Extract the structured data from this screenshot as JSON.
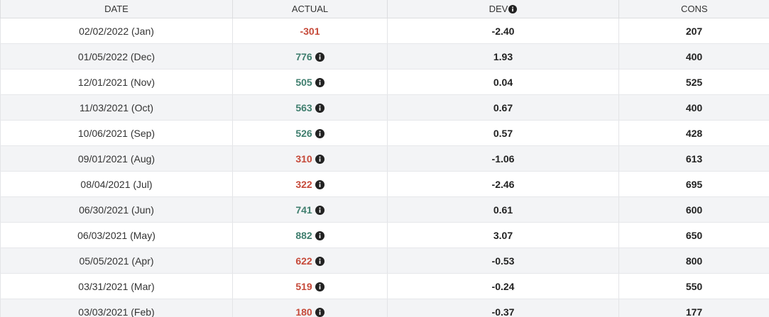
{
  "header": {
    "date": "DATE",
    "actual": "ACTUAL",
    "dev": "DEV",
    "cons": "CONS"
  },
  "colors": {
    "positive": "#3f7e6e",
    "negative": "#c64a3a"
  },
  "rows": [
    {
      "date": "02/02/2022 (Jan)",
      "actual": "-301",
      "status": "neg",
      "info": false,
      "dev": "-2.40",
      "cons": "207"
    },
    {
      "date": "01/05/2022 (Dec)",
      "actual": "776",
      "status": "pos",
      "info": true,
      "dev": "1.93",
      "cons": "400"
    },
    {
      "date": "12/01/2021 (Nov)",
      "actual": "505",
      "status": "pos",
      "info": true,
      "dev": "0.04",
      "cons": "525"
    },
    {
      "date": "11/03/2021 (Oct)",
      "actual": "563",
      "status": "pos",
      "info": true,
      "dev": "0.67",
      "cons": "400"
    },
    {
      "date": "10/06/2021 (Sep)",
      "actual": "526",
      "status": "pos",
      "info": true,
      "dev": "0.57",
      "cons": "428"
    },
    {
      "date": "09/01/2021 (Aug)",
      "actual": "310",
      "status": "neg",
      "info": true,
      "dev": "-1.06",
      "cons": "613"
    },
    {
      "date": "08/04/2021 (Jul)",
      "actual": "322",
      "status": "neg",
      "info": true,
      "dev": "-2.46",
      "cons": "695"
    },
    {
      "date": "06/30/2021 (Jun)",
      "actual": "741",
      "status": "pos",
      "info": true,
      "dev": "0.61",
      "cons": "600"
    },
    {
      "date": "06/03/2021 (May)",
      "actual": "882",
      "status": "pos",
      "info": true,
      "dev": "3.07",
      "cons": "650"
    },
    {
      "date": "05/05/2021 (Apr)",
      "actual": "622",
      "status": "neg",
      "info": true,
      "dev": "-0.53",
      "cons": "800"
    },
    {
      "date": "03/31/2021 (Mar)",
      "actual": "519",
      "status": "neg",
      "info": true,
      "dev": "-0.24",
      "cons": "550"
    },
    {
      "date": "03/03/2021 (Feb)",
      "actual": "180",
      "status": "neg",
      "info": true,
      "dev": "-0.37",
      "cons": "177"
    }
  ]
}
